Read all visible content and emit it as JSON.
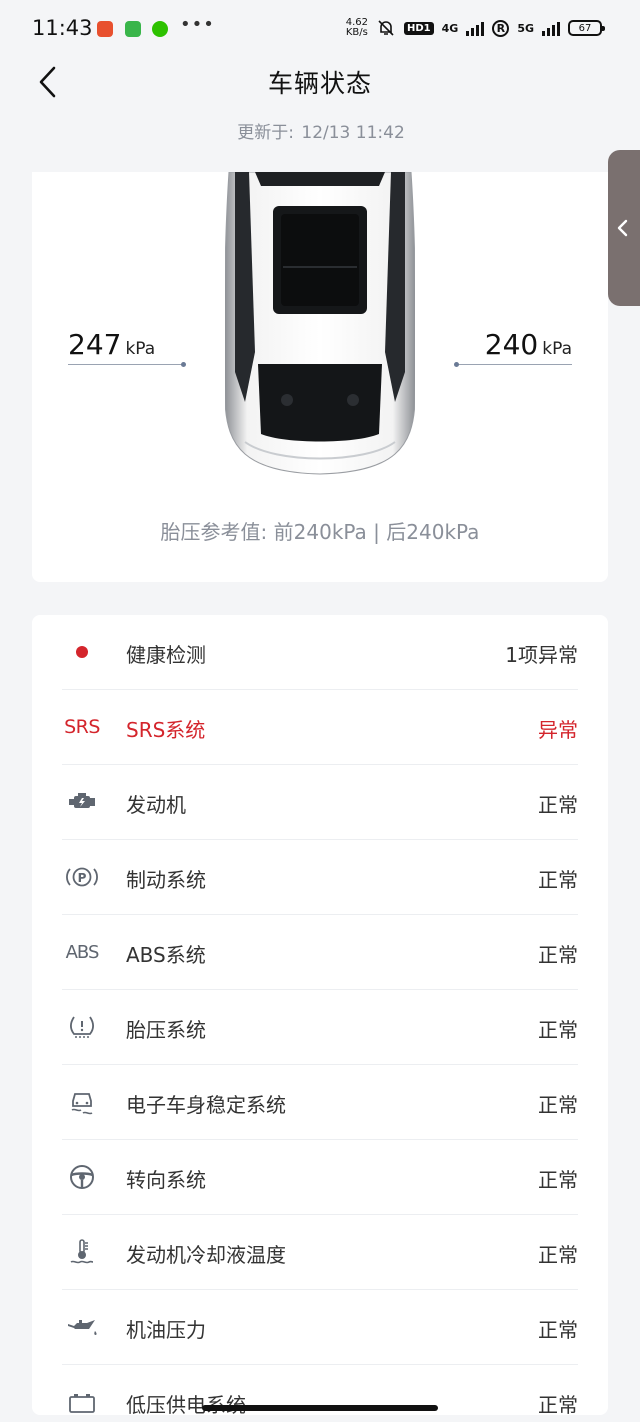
{
  "status_bar": {
    "time": "11:43",
    "speed_value": "4.62",
    "speed_unit": "KB/s",
    "hd": "HD1",
    "net1": "4G",
    "net2": "5G",
    "roaming": "R",
    "battery": "67",
    "more": "•••"
  },
  "header": {
    "title": "车辆状态",
    "updated_label": "更新于:",
    "updated_time": "12/13 11:42"
  },
  "tyre": {
    "left_value": "247",
    "right_value": "240",
    "unit": "kPa",
    "reference_text": "胎压参考值: 前240kPa | 后240kPa"
  },
  "systems": [
    {
      "icon": "red-dot-icon",
      "name": "健康检测",
      "state": "1项异常",
      "warn": false
    },
    {
      "icon": "srs-icon",
      "icon_text": "SRS",
      "name": "SRS系统",
      "state": "异常",
      "warn": true
    },
    {
      "icon": "engine-icon",
      "name": "发动机",
      "state": "正常",
      "warn": false
    },
    {
      "icon": "parking-brake-icon",
      "name": "制动系统",
      "state": "正常",
      "warn": false
    },
    {
      "icon": "abs-icon",
      "icon_text": "ABS",
      "name": "ABS系统",
      "state": "正常",
      "warn": false
    },
    {
      "icon": "tyre-pressure-icon",
      "name": "胎压系统",
      "state": "正常",
      "warn": false
    },
    {
      "icon": "stability-control-icon",
      "name": "电子车身稳定系统",
      "state": "正常",
      "warn": false
    },
    {
      "icon": "steering-wheel-icon",
      "name": "转向系统",
      "state": "正常",
      "warn": false
    },
    {
      "icon": "coolant-temperature-icon",
      "name": "发动机冷却液温度",
      "state": "正常",
      "warn": false
    },
    {
      "icon": "oil-pressure-icon",
      "name": "机油压力",
      "state": "正常",
      "warn": false
    },
    {
      "icon": "battery-icon",
      "name": "低压供电系统",
      "state": "正常",
      "warn": false
    }
  ],
  "colors": {
    "warning": "#d4252c",
    "background": "#f4f5f7",
    "muted_text": "#8a8f99",
    "side_tab": "#7a706f"
  }
}
